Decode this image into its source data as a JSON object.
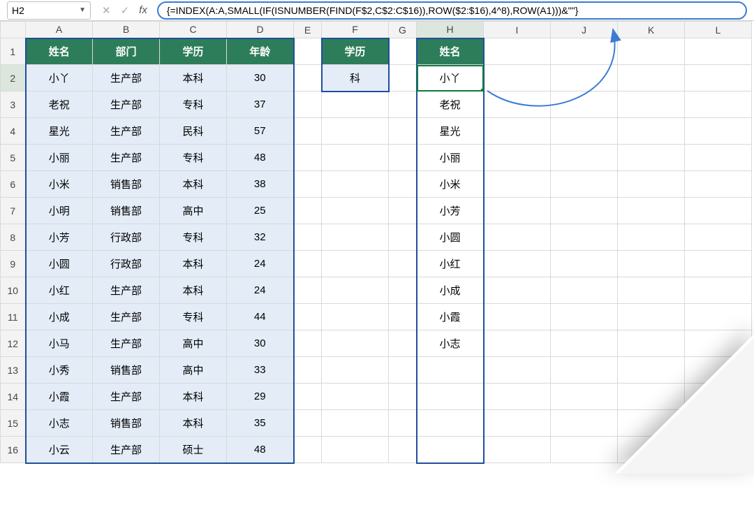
{
  "namebox": {
    "cell_ref": "H2"
  },
  "formula_bar": {
    "cancel_icon": "✕",
    "confirm_icon": "✓",
    "fx_label": "fx",
    "formula": "{=INDEX(A:A,SMALL(IF(ISNUMBER(FIND(F$2,C$2:C$16)),ROW($2:$16),4^8),ROW(A1)))&\"\"}"
  },
  "columns": [
    "A",
    "B",
    "C",
    "D",
    "E",
    "F",
    "G",
    "H",
    "I",
    "J",
    "K",
    "L"
  ],
  "row_numbers": [
    "1",
    "2",
    "3",
    "4",
    "5",
    "6",
    "7",
    "8",
    "9",
    "10",
    "11",
    "12",
    "13",
    "14",
    "15",
    "16"
  ],
  "headers_main": {
    "A": "姓名",
    "B": "部门",
    "C": "学历",
    "D": "年龄"
  },
  "headers_side": {
    "F": "学历",
    "H": "姓名"
  },
  "table_main": [
    {
      "name": "小丫",
      "dept": "生产部",
      "edu": "本科",
      "age": "30"
    },
    {
      "name": "老祝",
      "dept": "生产部",
      "edu": "专科",
      "age": "37"
    },
    {
      "name": "星光",
      "dept": "生产部",
      "edu": "民科",
      "age": "57"
    },
    {
      "name": "小丽",
      "dept": "生产部",
      "edu": "专科",
      "age": "48"
    },
    {
      "name": "小米",
      "dept": "销售部",
      "edu": "本科",
      "age": "38"
    },
    {
      "name": "小明",
      "dept": "销售部",
      "edu": "高中",
      "age": "25"
    },
    {
      "name": "小芳",
      "dept": "行政部",
      "edu": "专科",
      "age": "32"
    },
    {
      "name": "小圆",
      "dept": "行政部",
      "edu": "本科",
      "age": "24"
    },
    {
      "name": "小红",
      "dept": "生产部",
      "edu": "本科",
      "age": "24"
    },
    {
      "name": "小成",
      "dept": "生产部",
      "edu": "专科",
      "age": "44"
    },
    {
      "name": "小马",
      "dept": "生产部",
      "edu": "高中",
      "age": "30"
    },
    {
      "name": "小秀",
      "dept": "销售部",
      "edu": "高中",
      "age": "33"
    },
    {
      "name": "小霞",
      "dept": "生产部",
      "edu": "本科",
      "age": "29"
    },
    {
      "name": "小志",
      "dept": "销售部",
      "edu": "本科",
      "age": "35"
    },
    {
      "name": "小云",
      "dept": "生产部",
      "edu": "硕士",
      "age": "48"
    }
  ],
  "filter_value": "科",
  "result_names": [
    "小丫",
    "老祝",
    "星光",
    "小丽",
    "小米",
    "小芳",
    "小圆",
    "小红",
    "小成",
    "小霞",
    "小志",
    "",
    "",
    "",
    ""
  ]
}
